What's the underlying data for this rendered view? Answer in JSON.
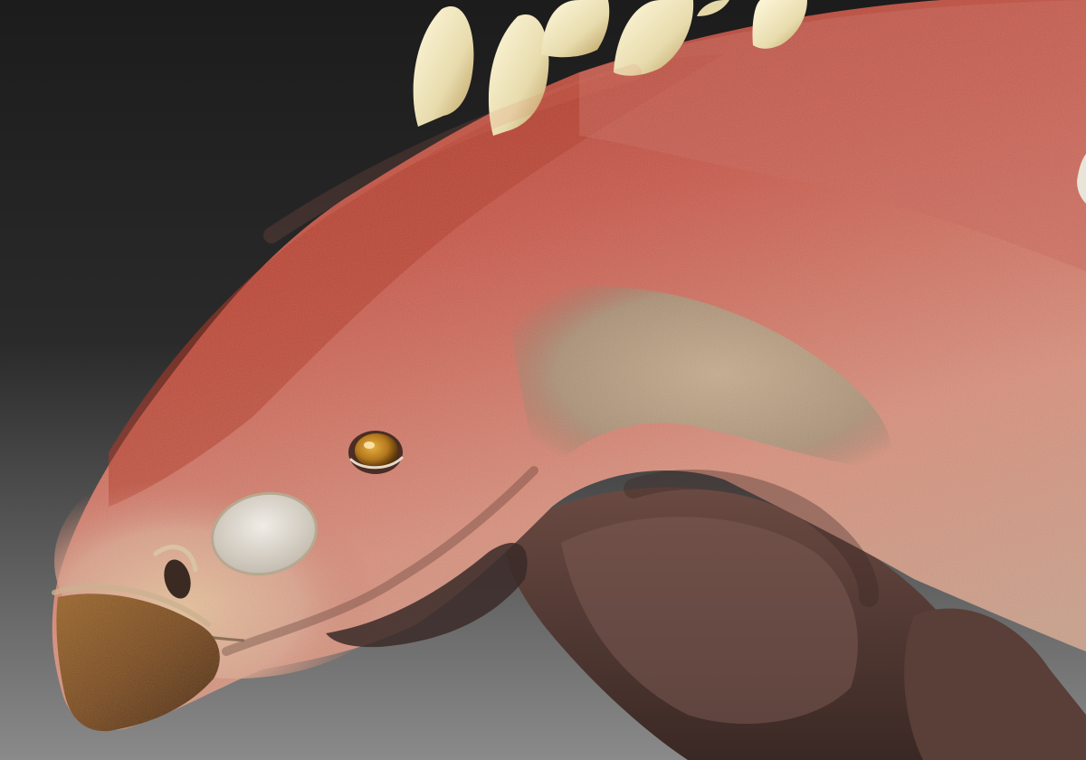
{
  "scene": {
    "subject": "dinosaur-head-sculpt",
    "colors": {
      "background_top": "#1c1c1c",
      "background_bottom": "#8a8a8a",
      "skin_top": "#b8402c",
      "skin_mid": "#d07a68",
      "skin_light": "#e0a490",
      "throat": "#b8a482",
      "beak": "#7a4a1e",
      "spike": "#efe6bf",
      "eye_iris": "#b4781e",
      "shadow_body": "#5a3e38"
    },
    "icons": {
      "eye": "eye-icon",
      "nostril": "nostril-icon",
      "spike": "spike-icon"
    }
  }
}
